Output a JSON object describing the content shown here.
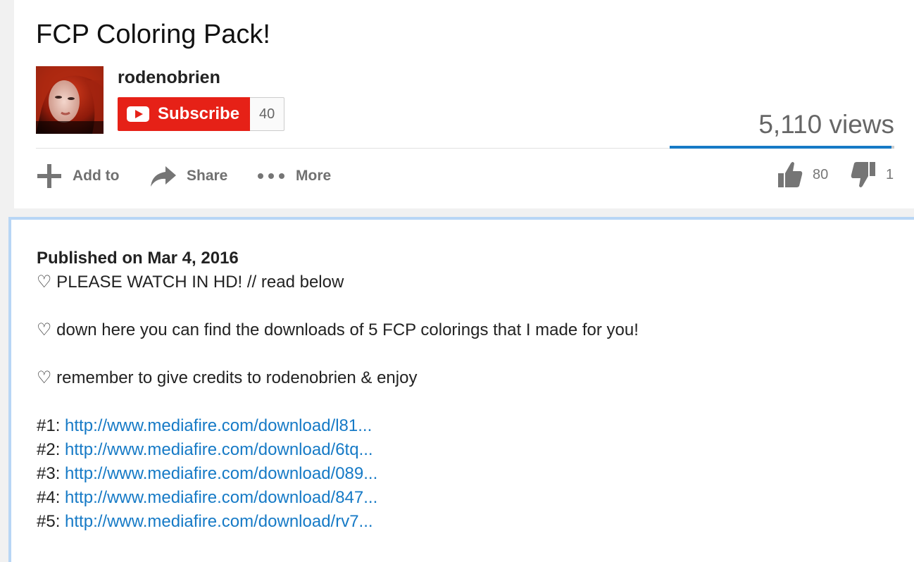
{
  "video": {
    "title": "FCP Coloring Pack!",
    "views": "5,110 views",
    "like_ratio": 0.9877
  },
  "channel": {
    "name": "rodenobrien",
    "subscribe_label": "Subscribe",
    "subscriber_count": "40"
  },
  "actions": {
    "add_label": "Add to",
    "share_label": "Share",
    "more_label": "More"
  },
  "ratings": {
    "likes": "80",
    "dislikes": "1"
  },
  "description": {
    "published": "Published on Mar 4, 2016",
    "line1": "♡ PLEASE WATCH IN HD! // read below",
    "line2": "♡ down here you can find the downloads of 5 FCP colorings that I made for you!",
    "line3": "♡ remember to give credits to rodenobrien & enjoy",
    "links": [
      {
        "prefix": "#1: ",
        "url": "http://www.mediafire.com/download/l81..."
      },
      {
        "prefix": "#2: ",
        "url": "http://www.mediafire.com/download/6tq..."
      },
      {
        "prefix": "#3: ",
        "url": "http://www.mediafire.com/download/089..."
      },
      {
        "prefix": "#4: ",
        "url": "http://www.mediafire.com/download/847..."
      },
      {
        "prefix": "#5: ",
        "url": "http://www.mediafire.com/download/rv7..."
      }
    ]
  },
  "colors": {
    "subscribe_red": "#e62117",
    "link_blue": "#167ac6",
    "desc_border": "#b8d6f5"
  },
  "icons": [
    "plus-icon",
    "share-arrow-icon",
    "more-dots-icon",
    "thumbs-up-icon",
    "thumbs-down-icon",
    "youtube-play-icon"
  ]
}
